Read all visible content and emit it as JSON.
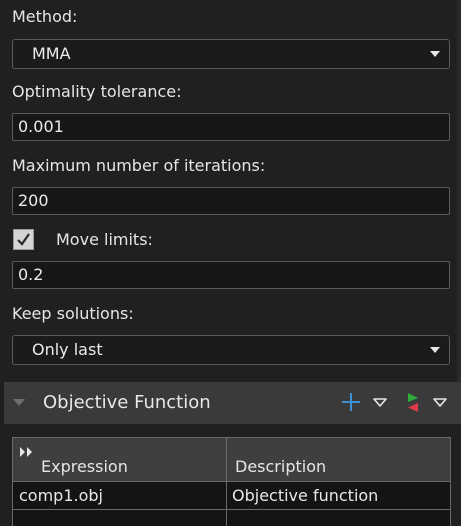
{
  "method": {
    "label": "Method:",
    "value": "MMA"
  },
  "optimality_tolerance": {
    "label": "Optimality tolerance:",
    "value": "0.001"
  },
  "max_iterations": {
    "label": "Maximum number of iterations:",
    "value": "200"
  },
  "move_limits": {
    "label": "Move limits:",
    "checked": true,
    "value": "0.2"
  },
  "keep_solutions": {
    "label": "Keep solutions:",
    "value": "Only last"
  },
  "objective_section": {
    "title": "Objective Function",
    "icons": [
      "collapse-triangle-icon",
      "add-plus-icon",
      "dropdown-arrow-icon",
      "evaluate-flag-icon",
      "dropdown-arrow-icon"
    ],
    "colors": {
      "plus": "#3d8fd6",
      "flag_green": "#2fae3c",
      "flag_red": "#e0394a"
    },
    "table": {
      "headers": [
        "Expression",
        "Description"
      ],
      "rows": [
        {
          "expression": "comp1.obj",
          "description": "Objective function"
        }
      ]
    }
  }
}
